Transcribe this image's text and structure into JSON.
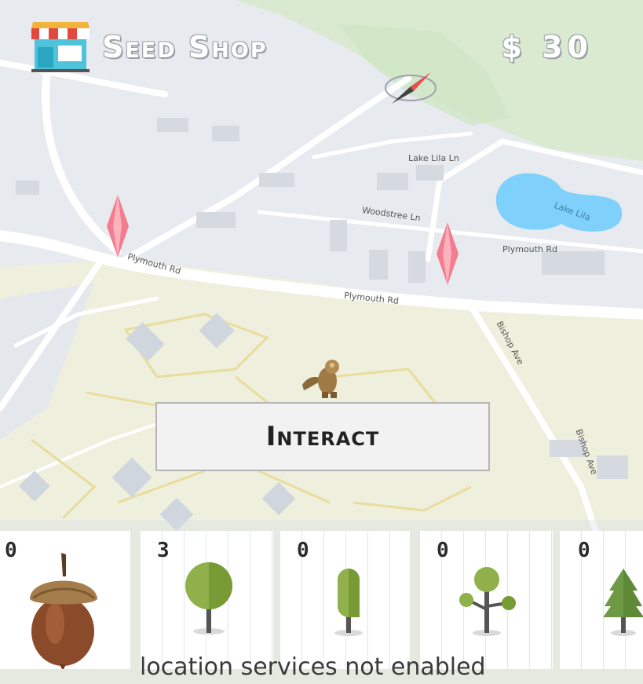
{
  "header": {
    "shop_label": "Seed Shop",
    "money": "$ 30"
  },
  "interact": {
    "label": "Interact"
  },
  "map": {
    "streets": [
      "Plymouth Rd",
      "Plymouth Rd",
      "Plymouth Rd",
      "Bishop Ave",
      "Bishop Ave",
      "Lake Lila Ln",
      "Woodstree Ln",
      "Lake Lila"
    ]
  },
  "inventory": [
    {
      "item": "acorn",
      "count": "0"
    },
    {
      "item": "round-tree",
      "count": "3"
    },
    {
      "item": "columnar-tree",
      "count": "0"
    },
    {
      "item": "branching-tree",
      "count": "0"
    },
    {
      "item": "pine-tree",
      "count": "0"
    }
  ],
  "status": "location services not enabled",
  "colors": {
    "accent_crystal": "#f47c8f",
    "lake": "#7fd0fb",
    "park": "#dcebd2",
    "road": "#ffffff",
    "tree_green": "#8fb04a"
  }
}
